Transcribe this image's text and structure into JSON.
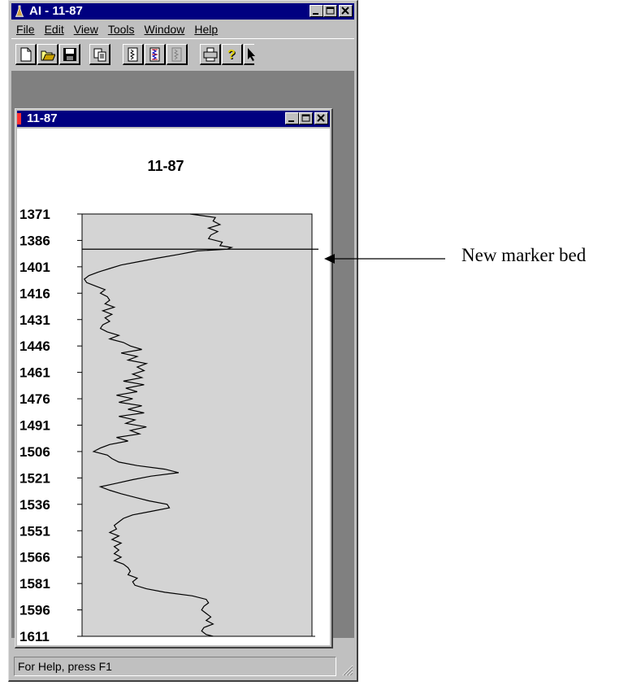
{
  "app": {
    "title": "AI - 11-87",
    "menu": [
      {
        "label": "File",
        "mnemonic": "F",
        "rest": "ile"
      },
      {
        "label": "Edit",
        "mnemonic": "E",
        "rest": "dit"
      },
      {
        "label": "View",
        "mnemonic": "V",
        "rest": "iew"
      },
      {
        "label": "Tools",
        "mnemonic": "T",
        "rest": "ools"
      },
      {
        "label": "Window",
        "mnemonic": "W",
        "rest": "indow"
      },
      {
        "label": "Help",
        "mnemonic": "H",
        "rest": "elp"
      }
    ],
    "toolbar": [
      "new-icon",
      "open-icon",
      "save-icon",
      "copy-icon",
      "log-track-icon",
      "log-track-colored-icon",
      "log-track-disabled-icon",
      "print-icon",
      "help-icon",
      "pointer-icon"
    ],
    "status_text": "For Help, press F1"
  },
  "child_window": {
    "title": "11-87"
  },
  "annotation": {
    "text": "New marker bed"
  },
  "colors": {
    "titlebar": "#000080",
    "face": "#c0c0c0",
    "plot_bg": "#d4d4d4"
  },
  "chart_data": {
    "type": "line",
    "title": "11-87",
    "orientation": "depth-vertical",
    "y_ticks": [
      1371,
      1386,
      1401,
      1416,
      1431,
      1446,
      1461,
      1476,
      1491,
      1506,
      1521,
      1536,
      1551,
      1566,
      1581,
      1596,
      1611
    ],
    "ylim": [
      1371,
      1611
    ],
    "xlim": [
      0,
      100
    ],
    "marker_depth": 1391,
    "series": [
      {
        "depth": [
          1371,
          1373,
          1375,
          1377,
          1379,
          1381,
          1383,
          1385,
          1387,
          1389,
          1390,
          1391,
          1392,
          1394,
          1396,
          1398,
          1400,
          1402,
          1404,
          1406,
          1408,
          1410,
          1412,
          1414,
          1416,
          1418,
          1420,
          1422,
          1424,
          1426,
          1428,
          1430,
          1432,
          1434,
          1436,
          1438,
          1440,
          1442,
          1444,
          1446,
          1448,
          1450,
          1452,
          1454,
          1456,
          1458,
          1460,
          1462,
          1464,
          1466,
          1468,
          1470,
          1472,
          1474,
          1476,
          1478,
          1480,
          1482,
          1484,
          1486,
          1488,
          1490,
          1492,
          1494,
          1496,
          1498,
          1500,
          1502,
          1504,
          1506,
          1508,
          1510,
          1512,
          1514,
          1516,
          1518,
          1520,
          1522,
          1524,
          1526,
          1528,
          1530,
          1532,
          1534,
          1536,
          1538,
          1540,
          1542,
          1544,
          1546,
          1548,
          1550,
          1552,
          1554,
          1556,
          1558,
          1560,
          1562,
          1564,
          1566,
          1568,
          1570,
          1572,
          1574,
          1576,
          1578,
          1580,
          1582,
          1584,
          1586,
          1588,
          1590,
          1592,
          1594,
          1596,
          1598,
          1600,
          1602,
          1604,
          1606,
          1608,
          1610,
          1611
        ],
        "values": [
          47,
          58,
          57,
          60,
          55,
          59,
          56,
          55,
          61,
          60,
          65,
          63,
          50,
          42,
          33,
          25,
          17,
          12,
          7,
          3,
          1,
          2,
          6,
          10,
          8,
          11,
          12,
          10,
          14,
          9,
          13,
          10,
          12,
          9,
          8,
          11,
          16,
          12,
          18,
          21,
          26,
          17,
          24,
          20,
          28,
          24,
          27,
          22,
          26,
          18,
          27,
          19,
          24,
          15,
          22,
          16,
          26,
          20,
          27,
          16,
          23,
          19,
          28,
          21,
          25,
          15,
          20,
          12,
          8,
          5,
          11,
          13,
          16,
          24,
          36,
          42,
          30,
          22,
          15,
          8,
          12,
          17,
          23,
          29,
          37,
          38,
          30,
          22,
          18,
          16,
          14,
          15,
          12,
          16,
          13,
          17,
          14,
          16,
          14,
          17,
          14,
          18,
          20,
          21,
          20,
          24,
          22,
          23,
          28,
          36,
          48,
          54,
          55,
          53,
          52,
          54,
          56,
          54,
          57,
          53,
          52,
          54,
          57,
          56,
          51,
          48,
          46,
          50,
          49
        ]
      }
    ]
  }
}
